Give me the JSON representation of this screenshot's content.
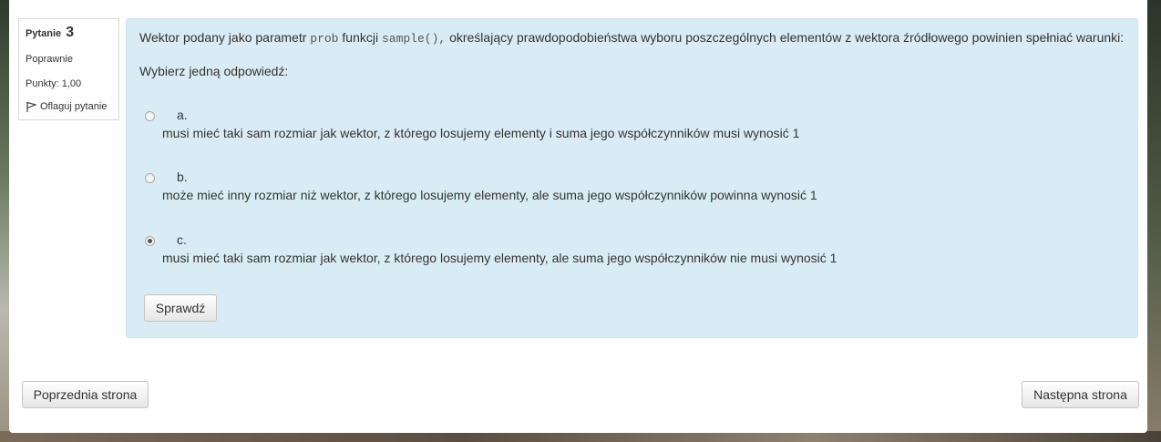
{
  "question": {
    "label": "Pytanie",
    "number": "3",
    "state": "Poprawnie",
    "grade": "Punkty: 1,00",
    "flag_label": "Oflaguj pytanie",
    "text_before": "Wektor podany jako parametr ",
    "code1": "prob",
    "text_middle": " funkcji ",
    "code2": "sample(),",
    "text_after": "  określający prawdopodobieństwa wyboru poszczególnych elementów z wektora źródłowego powinien spełniać warunki:",
    "prompt": "Wybierz jedną odpowiedź:",
    "answers": [
      {
        "letter": "a.",
        "text": "musi mieć taki sam rozmiar jak wektor, z którego losujemy elementy i suma jego współczynników musi wynosić 1",
        "selected": false
      },
      {
        "letter": "b.",
        "text": "może mieć inny rozmiar niż wektor, z którego losujemy elementy, ale suma jego współczynników powinna wynosić 1",
        "selected": false
      },
      {
        "letter": "c.",
        "text": "musi mieć taki sam rozmiar jak wektor, z którego losujemy elementy, ale suma jego współczynników nie musi wynosić 1",
        "selected": true
      }
    ],
    "check_label": "Sprawdź"
  },
  "navigation": {
    "prev_label": "Poprzednia strona",
    "next_label": "Następna strona"
  },
  "colors": {
    "content_bg": "#d9ecf5",
    "text": "#333333"
  }
}
